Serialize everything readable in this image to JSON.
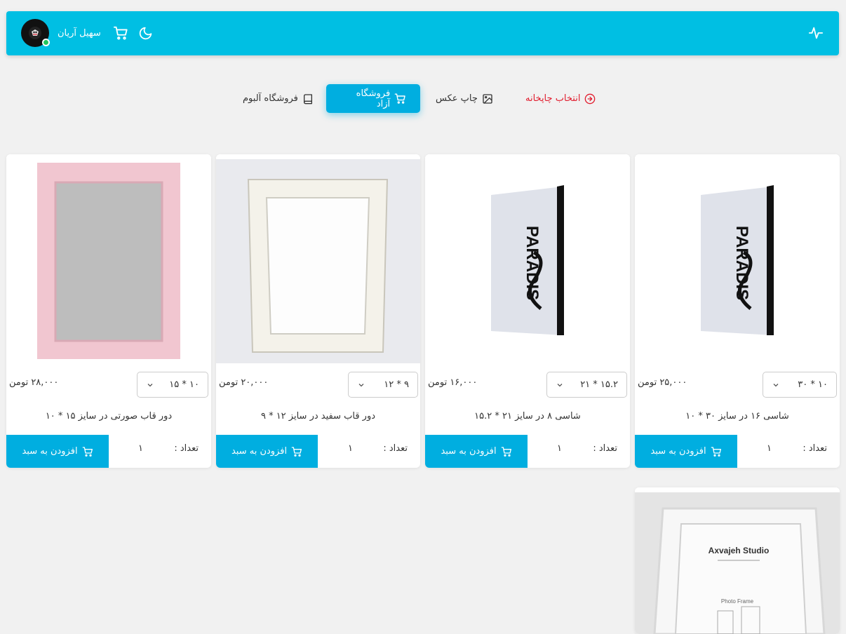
{
  "header": {
    "username": "سهیل آریان",
    "icons": [
      "pulse-icon",
      "avatar",
      "cart-icon",
      "moon-icon"
    ]
  },
  "menu": {
    "items": [
      {
        "label": "انتخاب چاپخانه",
        "icon": "arrow-circle-icon"
      },
      {
        "label": "چاپ عکس",
        "icon": "image-icon"
      },
      {
        "label": "فروشگاه آزاد",
        "icon": "cart-icon"
      },
      {
        "label": "فروشگاه آلبوم",
        "icon": "book-icon"
      }
    ]
  },
  "products": [
    {
      "title": "شاسی ۱۶ در سایز ۳۰ * ۱۰",
      "size": "۳۰ * ۱۰",
      "price": "۲۵,۰۰۰ تومن",
      "qty_label": "تعداد :",
      "qty": "۱",
      "add_label": "افزودن به سبد",
      "image_text": "PARADIS"
    },
    {
      "title": "شاسی ۸ در سایز ۲۱ * ۱۵.۲",
      "size": "۲۱ * ۱۵.۲",
      "price": "۱۶,۰۰۰ تومن",
      "qty_label": "تعداد :",
      "qty": "۱",
      "add_label": "افزودن به سبد",
      "image_text": "PARADIS"
    },
    {
      "title": "دور قاب سفید در سایز ۱۲ * ۹",
      "size": "۱۲ * ۹",
      "price": "۲۰,۰۰۰ تومن",
      "qty_label": "تعداد :",
      "qty": "۱",
      "add_label": "افزودن به سبد"
    },
    {
      "title": "دور قاب صورتی در سایز ۱۵ * ۱۰",
      "size": "۱۵ * ۱۰",
      "price": "۲۸,۰۰۰ تومن",
      "qty_label": "تعداد :",
      "qty": "۱",
      "add_label": "افزودن به سبد"
    },
    {
      "image_text": "Axvajeh Studio",
      "image_subtext": "Photo Frame"
    }
  ],
  "colors": {
    "header": "#00bfe3",
    "accent": "#00aee0",
    "danger": "#e11d2e",
    "online": "#22c55e"
  }
}
